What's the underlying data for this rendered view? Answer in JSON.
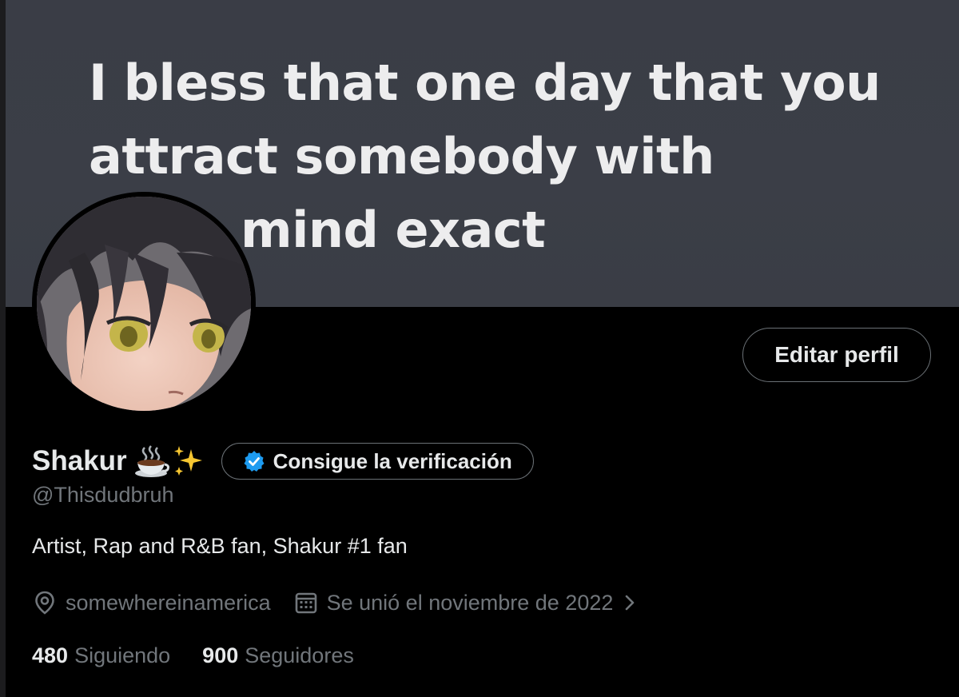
{
  "banner": {
    "lines": [
      "I bless that one day that you",
      "attract somebody with",
      "mind exact"
    ]
  },
  "profile": {
    "display_name": "Shakur",
    "emojis": [
      "hot-beverage-emoji",
      "sparkles-emoji"
    ],
    "handle": "@Thisdudbruh",
    "bio": "Artist, Rap and R&B fan, Shakur #1 fan",
    "location": "somewhereinamerica",
    "joined": "Se unió el noviembre de 2022"
  },
  "buttons": {
    "edit_profile": "Editar perfil",
    "get_verified": "Consigue la verificación"
  },
  "stats": {
    "following_count": "480",
    "following_label": "Siguiendo",
    "followers_count": "900",
    "followers_label": "Seguidores"
  },
  "colors": {
    "background": "#000000",
    "banner": "#3b3e47",
    "primary_text": "#e7e9ea",
    "secondary_text": "#71767b",
    "verify_badge": "#1d9bf0",
    "button_border": "#6b7176"
  }
}
